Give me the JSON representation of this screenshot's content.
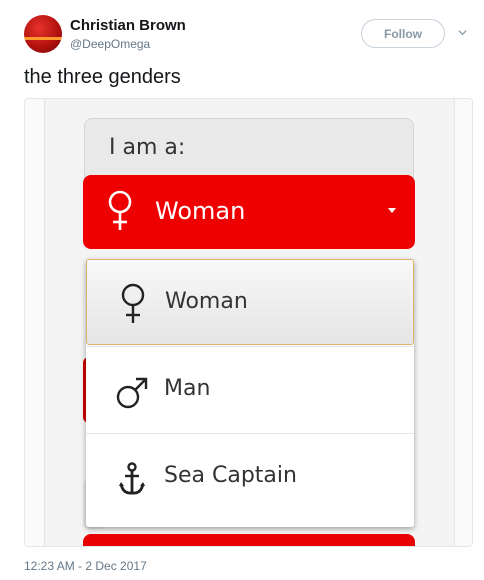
{
  "tweet": {
    "author_name": "Christian Brown",
    "author_handle": "@DeepOmega",
    "follow_label": "Follow",
    "text": "the three genders",
    "timestamp": "12:23 AM - 2 Dec 2017"
  },
  "form": {
    "label": "I am a:",
    "selected_value": "Woman",
    "options": [
      {
        "label": "Woman",
        "icon": "female-symbol-icon"
      },
      {
        "label": "Man",
        "icon": "male-symbol-icon"
      },
      {
        "label": "Sea Captain",
        "icon": "anchor-icon"
      }
    ]
  },
  "colors": {
    "select_red": "#ef0000",
    "follow_border": "#c9d3dc",
    "handle_grey": "#657786"
  }
}
